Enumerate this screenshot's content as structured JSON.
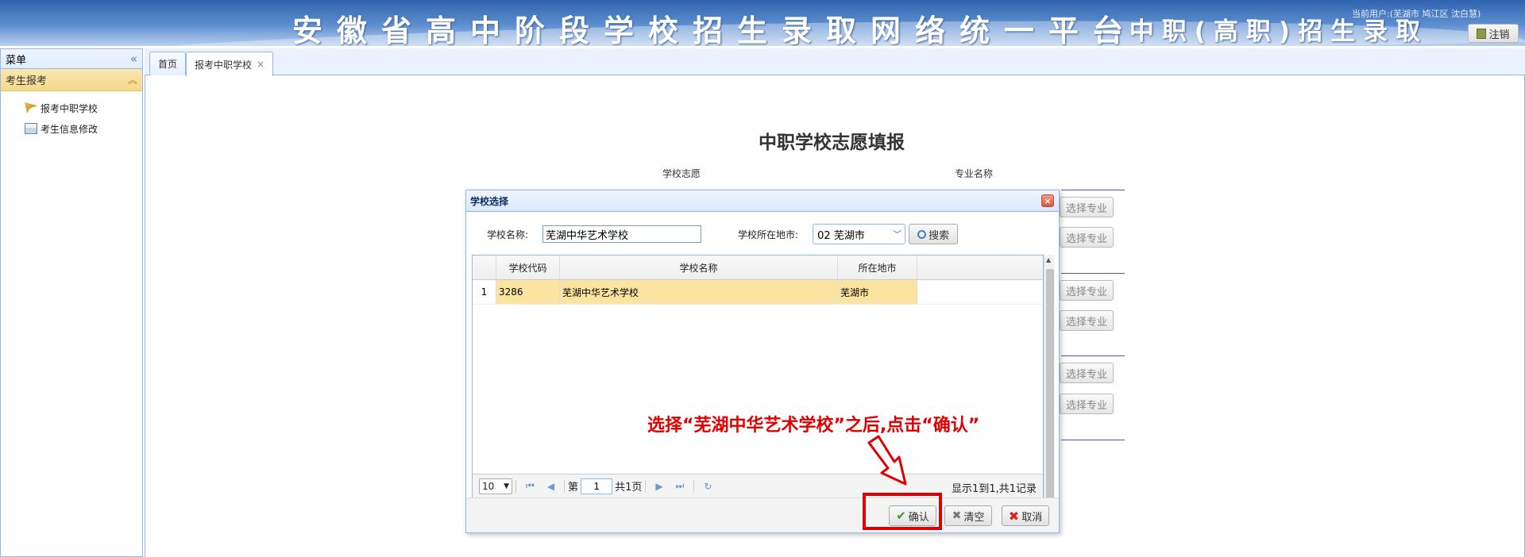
{
  "header": {
    "title": "安徽省高中阶段学校招生录取网络统一平台",
    "subtitle": "--中职(高职)招生录取",
    "current_user": "当前用户:(芜湖市 鸠江区 沈白慧)",
    "logout_label": "注销"
  },
  "sidebar": {
    "title": "菜单",
    "panel_title": "考生报考",
    "items": [
      {
        "label": "报考中职学校",
        "icon": "flag-icon"
      },
      {
        "label": "考生信息修改",
        "icon": "form-icon"
      }
    ]
  },
  "tabs": [
    {
      "label": "首页"
    },
    {
      "label": "报考中职学校",
      "close": "×"
    }
  ],
  "main": {
    "title": "中职学校志愿填报",
    "col_school": "学校志愿",
    "col_major": "专业名称",
    "select_major_label": "选择专业"
  },
  "dialog": {
    "title": "学校选择",
    "close": "×",
    "school_label": "学校名称:",
    "school_value": "芜湖中华艺术学校",
    "city_label": "学校所在地市:",
    "city_value": "02 芜湖市",
    "search_label": "搜索",
    "columns": {
      "code": "学校代码",
      "name": "学校名称",
      "city": "所在地市"
    },
    "rows": [
      {
        "num": "1",
        "code": "3286",
        "name": "芜湖中华艺术学校",
        "city": "芜湖市"
      }
    ],
    "pager": {
      "page_size": "10",
      "page_prefix": "第",
      "page_value": "1",
      "page_suffix": "共1页",
      "info": "显示1到1,共1记录"
    },
    "buttons": {
      "confirm": "确认",
      "clear": "清空",
      "cancel": "取消"
    }
  },
  "annotation": "选择“芜湖中华艺术学校”之后,点击“确认”",
  "colors": {
    "header": "#2f63ad",
    "highlight": "#e00000",
    "row_selected": "#fbe3a0",
    "border": "#95b8e7"
  }
}
